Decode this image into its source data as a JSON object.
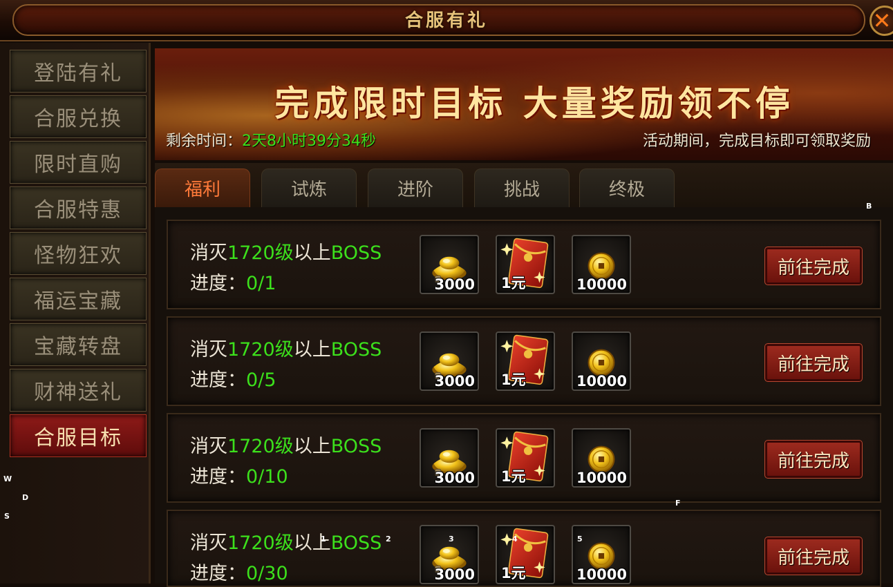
{
  "window": {
    "title": "合服有礼",
    "close_label": "✕"
  },
  "sidebar": {
    "items": [
      {
        "label": "登陆有礼",
        "active": false
      },
      {
        "label": "合服兑换",
        "active": false
      },
      {
        "label": "限时直购",
        "active": false
      },
      {
        "label": "合服特惠",
        "active": false
      },
      {
        "label": "怪物狂欢",
        "active": false
      },
      {
        "label": "福运宝藏",
        "active": false
      },
      {
        "label": "宝藏转盘",
        "active": false
      },
      {
        "label": "财神送礼",
        "active": false
      },
      {
        "label": "合服目标",
        "active": true
      }
    ]
  },
  "banner": {
    "title": "完成限时目标 大量奖励领不停",
    "remain_label": "剩余时间：",
    "remain_value": "2天8小时39分34秒",
    "notice": "活动期间，完成目标即可领取奖励"
  },
  "tabs": [
    {
      "label": "福利",
      "active": true
    },
    {
      "label": "试炼",
      "active": false
    },
    {
      "label": "进阶",
      "active": false
    },
    {
      "label": "挑战",
      "active": false
    },
    {
      "label": "终极",
      "active": false
    }
  ],
  "tasks": [
    {
      "prefix": "消灭",
      "level": "1720级",
      "mid": "以上",
      "target": "BOSS",
      "progress_label": "进度：",
      "progress": "0/1",
      "rewards": [
        {
          "icon": "gold-ingot-icon",
          "count": "3000"
        },
        {
          "icon": "red-envelope-icon",
          "count": "1元"
        },
        {
          "icon": "gold-coin-icon",
          "count": "10000"
        }
      ],
      "button": "前往完成"
    },
    {
      "prefix": "消灭",
      "level": "1720级",
      "mid": "以上",
      "target": "BOSS",
      "progress_label": "进度：",
      "progress": "0/5",
      "rewards": [
        {
          "icon": "gold-ingot-icon",
          "count": "3000"
        },
        {
          "icon": "red-envelope-icon",
          "count": "1元"
        },
        {
          "icon": "gold-coin-icon",
          "count": "10000"
        }
      ],
      "button": "前往完成"
    },
    {
      "prefix": "消灭",
      "level": "1720级",
      "mid": "以上",
      "target": "BOSS",
      "progress_label": "进度：",
      "progress": "0/10",
      "rewards": [
        {
          "icon": "gold-ingot-icon",
          "count": "3000"
        },
        {
          "icon": "red-envelope-icon",
          "count": "1元"
        },
        {
          "icon": "gold-coin-icon",
          "count": "10000"
        }
      ],
      "button": "前往完成"
    },
    {
      "prefix": "消灭",
      "level": "1720级",
      "mid": "以上",
      "target": "BOSS",
      "progress_label": "进度：",
      "progress": "0/30",
      "rewards": [
        {
          "icon": "gold-ingot-icon",
          "count": "3000"
        },
        {
          "icon": "red-envelope-icon",
          "count": "1元"
        },
        {
          "icon": "gold-coin-icon",
          "count": "10000"
        }
      ],
      "button": "前往完成"
    }
  ],
  "key_hints": [
    "B",
    "F",
    "W",
    "D",
    "S",
    "1",
    "2",
    "3",
    "4",
    "5"
  ],
  "colors": {
    "highlight_green": "#3ce01c",
    "tab_active_text": "#ff7a3a",
    "button_red": "#9c2a1e",
    "gold_title": "#e6c27a"
  }
}
